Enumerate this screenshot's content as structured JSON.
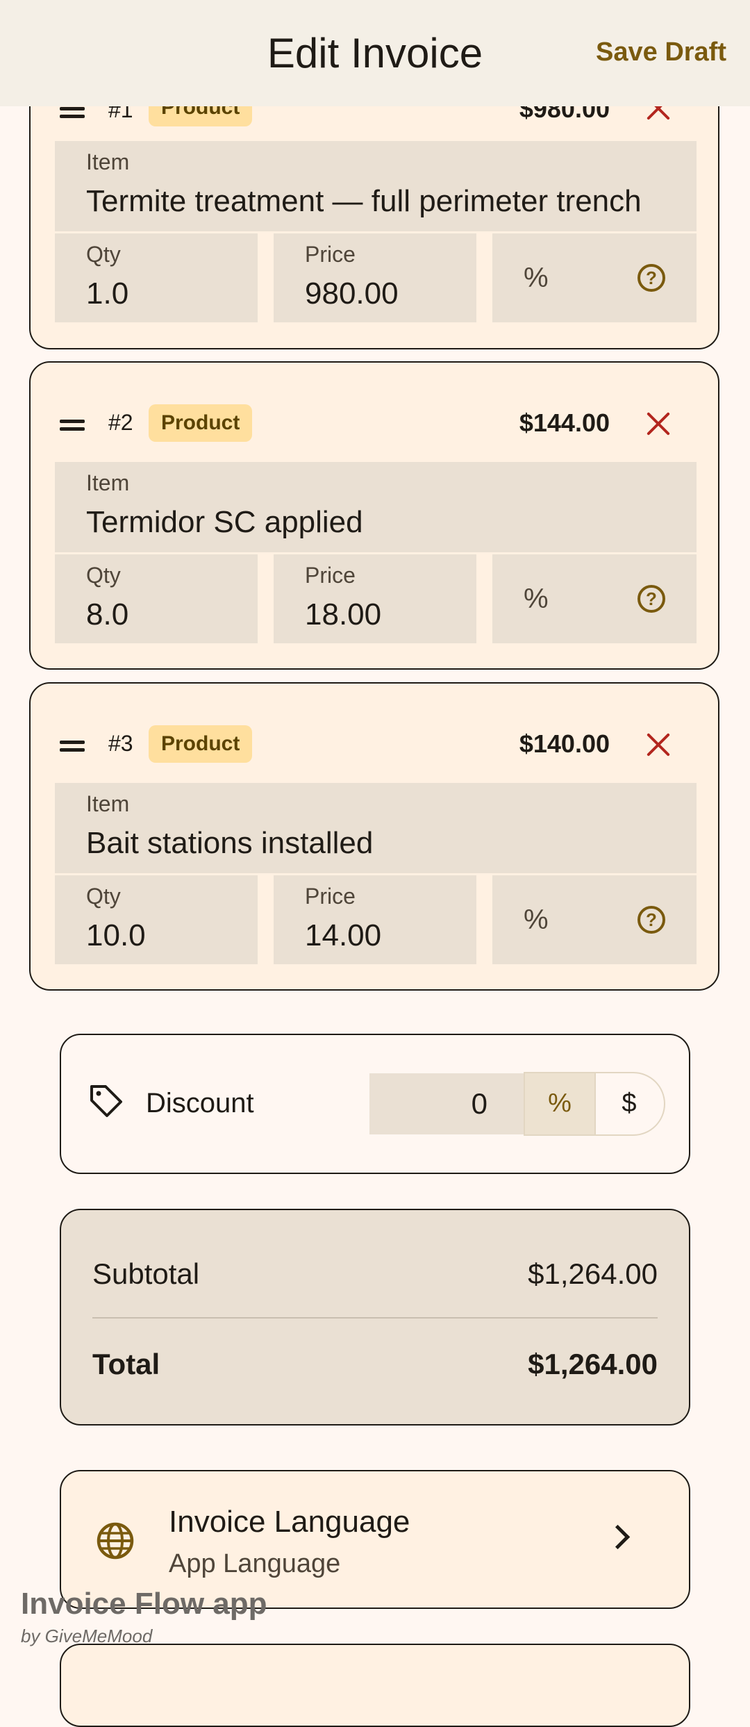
{
  "appbar": {
    "title": "Edit Invoice",
    "save_label": "Save Draft"
  },
  "items": [
    {
      "number": "#1",
      "badge": "Product",
      "amount": "$980.00",
      "item_label": "Item",
      "item_value": "Termite treatment — full perimeter trench",
      "qty_label": "Qty",
      "qty_value": "1.0",
      "price_label": "Price",
      "price_value": "980.00",
      "pct": "%"
    },
    {
      "number": "#2",
      "badge": "Product",
      "amount": "$144.00",
      "item_label": "Item",
      "item_value": "Termidor SC applied",
      "qty_label": "Qty",
      "qty_value": "8.0",
      "price_label": "Price",
      "price_value": "18.00",
      "pct": "%"
    },
    {
      "number": "#3",
      "badge": "Product",
      "amount": "$140.00",
      "item_label": "Item",
      "item_value": "Bait stations installed",
      "qty_label": "Qty",
      "qty_value": "10.0",
      "price_label": "Price",
      "price_value": "14.00",
      "pct": "%"
    }
  ],
  "discount": {
    "label": "Discount",
    "value": "0",
    "mode_percent": "%",
    "mode_dollar": "$",
    "selected": "percent"
  },
  "totals": {
    "subtotal_label": "Subtotal",
    "subtotal_value": "$1,264.00",
    "total_label": "Total",
    "total_value": "$1,264.00"
  },
  "language": {
    "title": "Invoice Language",
    "value": "App Language"
  },
  "watermark": {
    "name": "Invoice Flow app",
    "by": "by GiveMeMood"
  },
  "colors": {
    "accent": "#7A5A0E",
    "remove": "#B3261E",
    "badge_bg": "#FFDF9E",
    "card_bg": "#FFF1E2",
    "field_bg": "#EAE0D3"
  },
  "icons": {
    "drag": "drag-handle-icon",
    "remove": "close-icon",
    "help": "help-circle-icon",
    "tag": "tag-icon",
    "globe": "globe-icon",
    "chevron": "chevron-right-icon"
  }
}
